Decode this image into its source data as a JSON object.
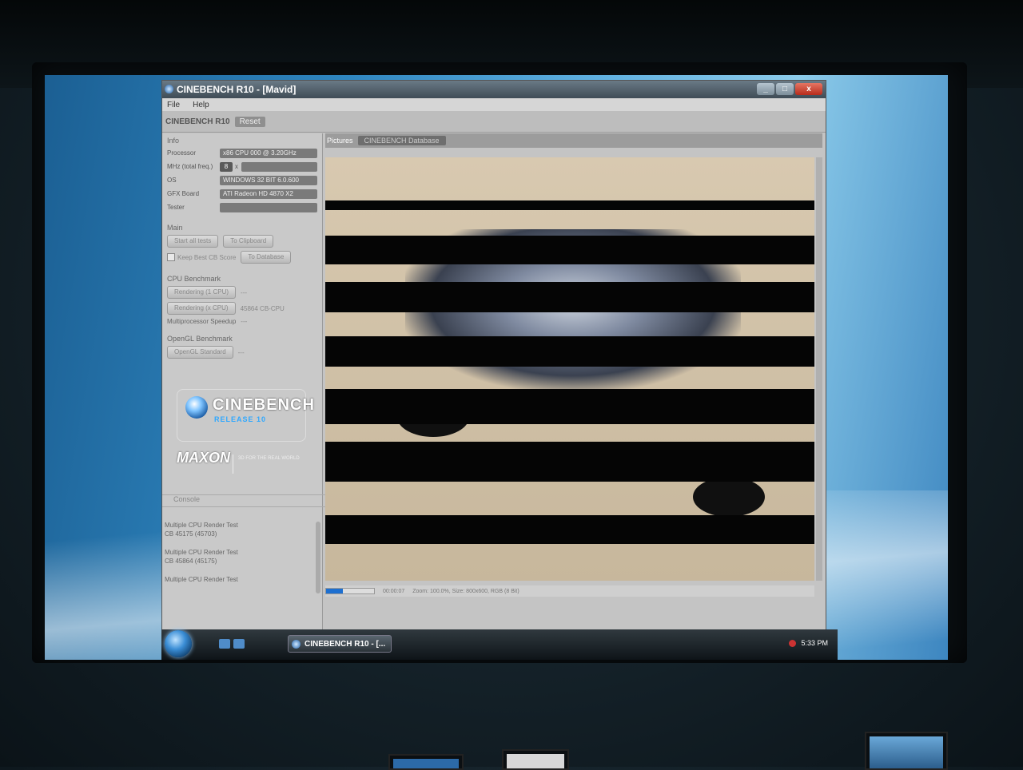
{
  "window": {
    "title": "CINEBENCH R10 - [Mavid]",
    "menu": [
      "File",
      "Help"
    ],
    "toolbar": {
      "label": "CINEBENCH R10",
      "button": "Reset"
    },
    "controls": [
      "_",
      "□",
      "x"
    ]
  },
  "info": {
    "heading": "Info",
    "processor_label": "Processor",
    "processor_value": "x86 CPU 000 @ 3.20GHz",
    "mhz_label": "MHz (total freq.)",
    "mhz_count": "8",
    "mhz_sep": "x",
    "os_label": "OS",
    "os_value": "WINDOWS 32 BIT 6.0.600",
    "gfx_label": "GFX Board",
    "gfx_value": "ATI Radeon HD 4870 X2",
    "tester_label": "Tester",
    "tester_value": ""
  },
  "main": {
    "heading": "Main",
    "start_all_tests": "Start all tests",
    "to_clipboard": "To Clipboard",
    "keep_best_label": "Keep Best CB Score",
    "to_database": "To Database"
  },
  "cpu": {
    "heading": "CPU Benchmark",
    "render_1cpu": "Rendering (1 CPU)",
    "render_1cpu_value": "---",
    "render_xcpu": "Rendering (x CPU)",
    "render_xcpu_value": "45864 CB-CPU",
    "speedup_label": "Multiprocessor Speedup",
    "speedup_value": "---"
  },
  "opengl": {
    "heading": "OpenGL Benchmark",
    "standard": "OpenGL Standard",
    "standard_value": "---"
  },
  "logo": {
    "cinebench": "CINEBENCH",
    "release": "RELEASE 10",
    "maxon": "MAXON",
    "maxon_tagline": "3D FOR THE REAL WORLD"
  },
  "console": {
    "heading": "Console",
    "lines": [
      "Multiple CPU Render Test",
      "CB 45175 (45703)",
      "Multiple CPU Render Test",
      "CB 45864 (45175)",
      "Multiple CPU Render Test"
    ]
  },
  "pictures": {
    "label": "Pictures",
    "selected": "CINEBENCH Database"
  },
  "status": {
    "time": "00:00:07",
    "zoom": "Zoom: 100.0%, Size: 800x600, RGB (8 Bit)",
    "progress": 0.35
  },
  "taskbar": {
    "task_label": "CINEBENCH R10 - [...",
    "clock": "5:33 PM"
  }
}
